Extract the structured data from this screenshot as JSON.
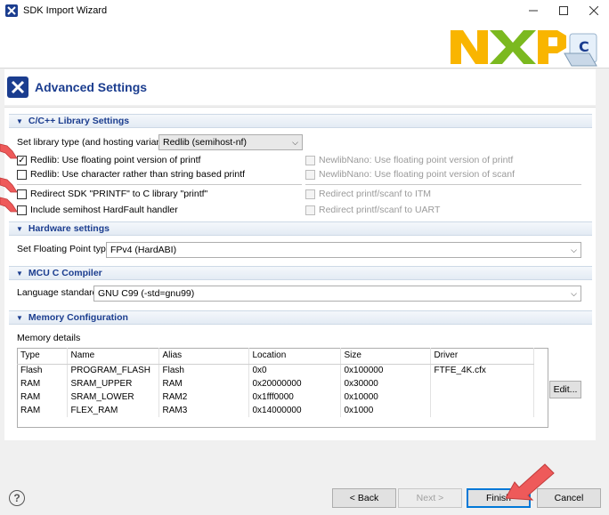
{
  "window": {
    "title": "SDK Import Wizard"
  },
  "page": {
    "title": "Advanced Settings"
  },
  "sections": {
    "library": "C/C++ Library Settings",
    "hardware": "Hardware settings",
    "compiler": "MCU C Compiler",
    "memory": "Memory Configuration"
  },
  "library": {
    "type_label": "Set library type (and hosting variant)",
    "type_value": "Redlib (semihost-nf)",
    "left_options": [
      {
        "label": "Redlib: Use floating point version of printf",
        "checked": true
      },
      {
        "label": "Redlib: Use character rather than string based printf",
        "checked": false
      },
      {
        "label": "Redirect SDK \"PRINTF\" to C library \"printf\"",
        "checked": false
      },
      {
        "label": "Include semihost HardFault handler",
        "checked": false
      }
    ],
    "right_options": [
      {
        "label": "NewlibNano: Use floating point version of printf",
        "checked": false
      },
      {
        "label": "NewlibNano: Use floating point version of scanf",
        "checked": false
      },
      {
        "label": "Redirect printf/scanf to ITM",
        "checked": false
      },
      {
        "label": "Redirect printf/scanf to UART",
        "checked": false
      }
    ]
  },
  "hardware": {
    "fp_label": "Set Floating Point type",
    "fp_value": "FPv4 (HardABI)"
  },
  "compiler": {
    "std_label": "Language standard",
    "std_value": "GNU C99 (-std=gnu99)"
  },
  "memory": {
    "details_label": "Memory details",
    "columns": [
      "Type",
      "Name",
      "Alias",
      "Location",
      "Size",
      "Driver"
    ],
    "rows": [
      [
        "Flash",
        "PROGRAM_FLASH",
        "Flash",
        "0x0",
        "0x100000",
        "FTFE_4K.cfx"
      ],
      [
        "RAM",
        "SRAM_UPPER",
        "RAM",
        "0x20000000",
        "0x30000",
        ""
      ],
      [
        "RAM",
        "SRAM_LOWER",
        "RAM2",
        "0x1fff0000",
        "0x10000",
        ""
      ],
      [
        "RAM",
        "FLEX_RAM",
        "RAM3",
        "0x14000000",
        "0x1000",
        ""
      ]
    ],
    "edit_button": "Edit..."
  },
  "buttons": {
    "back": "< Back",
    "next": "Next >",
    "finish": "Finish",
    "cancel": "Cancel",
    "help": "?"
  },
  "colors": {
    "accent": "#1b3d8f",
    "arrow": "#ee5a5a",
    "section_bg": "#e3ebf4"
  }
}
